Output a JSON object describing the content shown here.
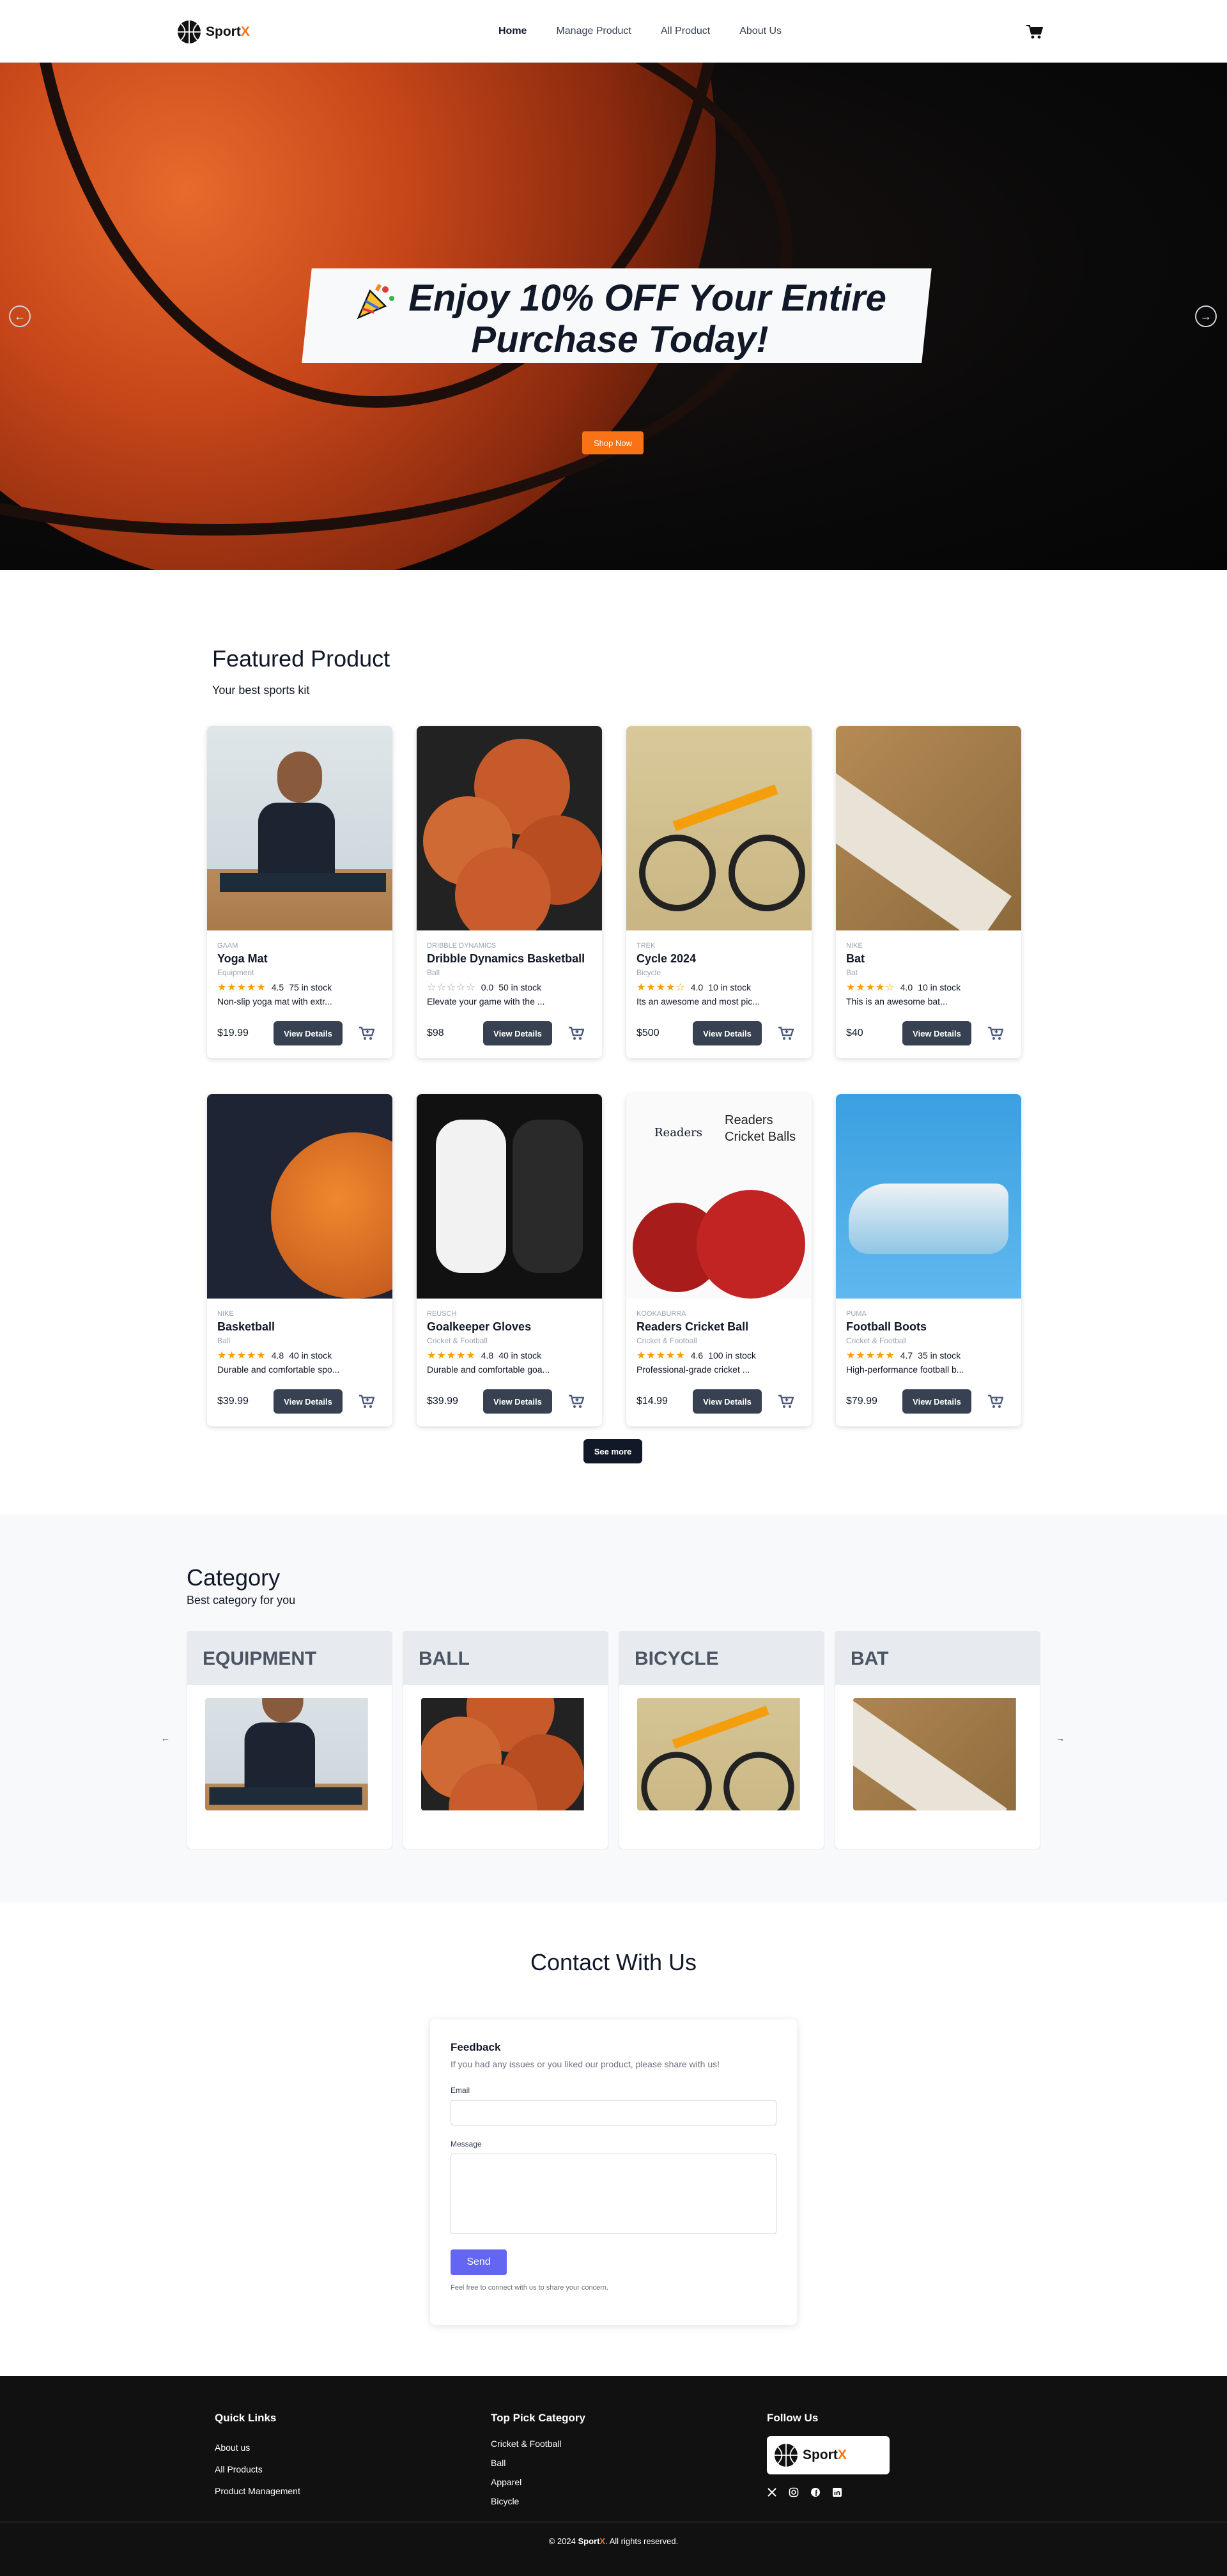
{
  "brand": {
    "name_main": "Sport",
    "name_accent": "X",
    "accent_color": "#f97316"
  },
  "nav": {
    "links": [
      "Home",
      "Manage Product",
      "All Product",
      "About Us"
    ],
    "active": "Home",
    "cart_icon": "cart-icon"
  },
  "hero": {
    "headline_line1": "Enjoy 10% OFF Your Entire",
    "headline_line2": "Purchase Today!",
    "button": "Shop Now",
    "prev_icon": "arrow-left-icon",
    "next_icon": "arrow-right-icon"
  },
  "featured": {
    "title": "Featured Product",
    "subtitle": "Your best sports kit",
    "view_label": "View Details",
    "see_more": "See more",
    "products": [
      {
        "brand": "GAAM",
        "name": "Yoga Mat",
        "category": "Equipment",
        "stars": "★★★★★",
        "stars_filled": 4.5,
        "rating": "4.5",
        "stock": "75 in stock",
        "desc": "Non-slip yoga mat with extr...",
        "price": "$19.99"
      },
      {
        "brand": "DRIBBLE DYNAMICS",
        "name": "Dribble Dynamics Basketball",
        "category": "Ball",
        "stars": "☆☆☆☆☆",
        "stars_filled": 0,
        "rating": "0.0",
        "stock": "50 in stock",
        "desc": "Elevate your game with the ...",
        "price": "$98"
      },
      {
        "brand": "TREK",
        "name": "Cycle 2024",
        "category": "Bicycle",
        "stars": "★★★★☆",
        "stars_filled": 4,
        "rating": "4.0",
        "stock": "10 in stock",
        "desc": "Its an awesome and most pic...",
        "price": "$500"
      },
      {
        "brand": "NIKE",
        "name": "Bat",
        "category": "Bat",
        "stars": "★★★★☆",
        "stars_filled": 4,
        "rating": "4.0",
        "stock": "10 in stock",
        "desc": "This is an awesome bat...",
        "price": "$40"
      },
      {
        "brand": "NIKE",
        "name": "Basketball",
        "category": "Ball",
        "stars": "★★★★★",
        "stars_filled": 5,
        "rating": "4.8",
        "stock": "40 in stock",
        "desc": "Durable and comfortable spo...",
        "price": "$39.99"
      },
      {
        "brand": "REUSCH",
        "name": "Goalkeeper Gloves",
        "category": "Cricket & Football",
        "stars": "★★★★★",
        "stars_filled": 5,
        "rating": "4.8",
        "stock": "40 in stock",
        "desc": "Durable and comfortable goa...",
        "price": "$39.99"
      },
      {
        "brand": "KOOKABURRA",
        "name": "Readers Cricket Ball",
        "category": "Cricket & Football",
        "stars": "★★★★★",
        "stars_filled": 4.5,
        "rating": "4.6",
        "stock": "100 in stock",
        "desc": "Professional-grade cricket ...",
        "price": "$14.99"
      },
      {
        "brand": "PUMA",
        "name": "Football Boots",
        "category": "Cricket & Football",
        "stars": "★★★★★",
        "stars_filled": 4.5,
        "rating": "4.7",
        "stock": "35 in stock",
        "desc": "High-performance football b...",
        "price": "$79.99"
      }
    ],
    "readers_text_line1": "Readers",
    "readers_text_line2": "Cricket Balls",
    "readers_logo": "Readers"
  },
  "category": {
    "title": "Category",
    "subtitle": "Best category for you",
    "items": [
      "EQUIPMENT",
      "BALL",
      "BICYCLE",
      "BAT"
    ],
    "prev_icon": "chevron-left-icon",
    "next_icon": "chevron-right-icon"
  },
  "contact": {
    "title": "Contact With Us",
    "form_title": "Feedback",
    "form_subtitle": "If you had any issues or you liked our product, please share with us!",
    "email_label": "Email",
    "message_label": "Message",
    "send": "Send",
    "note": "Feel free to connect with us to share your concern."
  },
  "footer": {
    "quick_links_title": "Quick Links",
    "quick_links": [
      "About us",
      "All Products",
      "Product Management"
    ],
    "top_pick_title": "Top Pick Category",
    "top_pick": [
      "Cricket & Football",
      "Ball",
      "Apparel",
      "Bicycle"
    ],
    "follow_title": "Follow Us",
    "social_icons": [
      "x-icon",
      "instagram-icon",
      "facebook-icon",
      "linkedin-icon"
    ],
    "copyright_prefix": "© 2024 ",
    "copyright_suffix": ". All rights reserved."
  }
}
